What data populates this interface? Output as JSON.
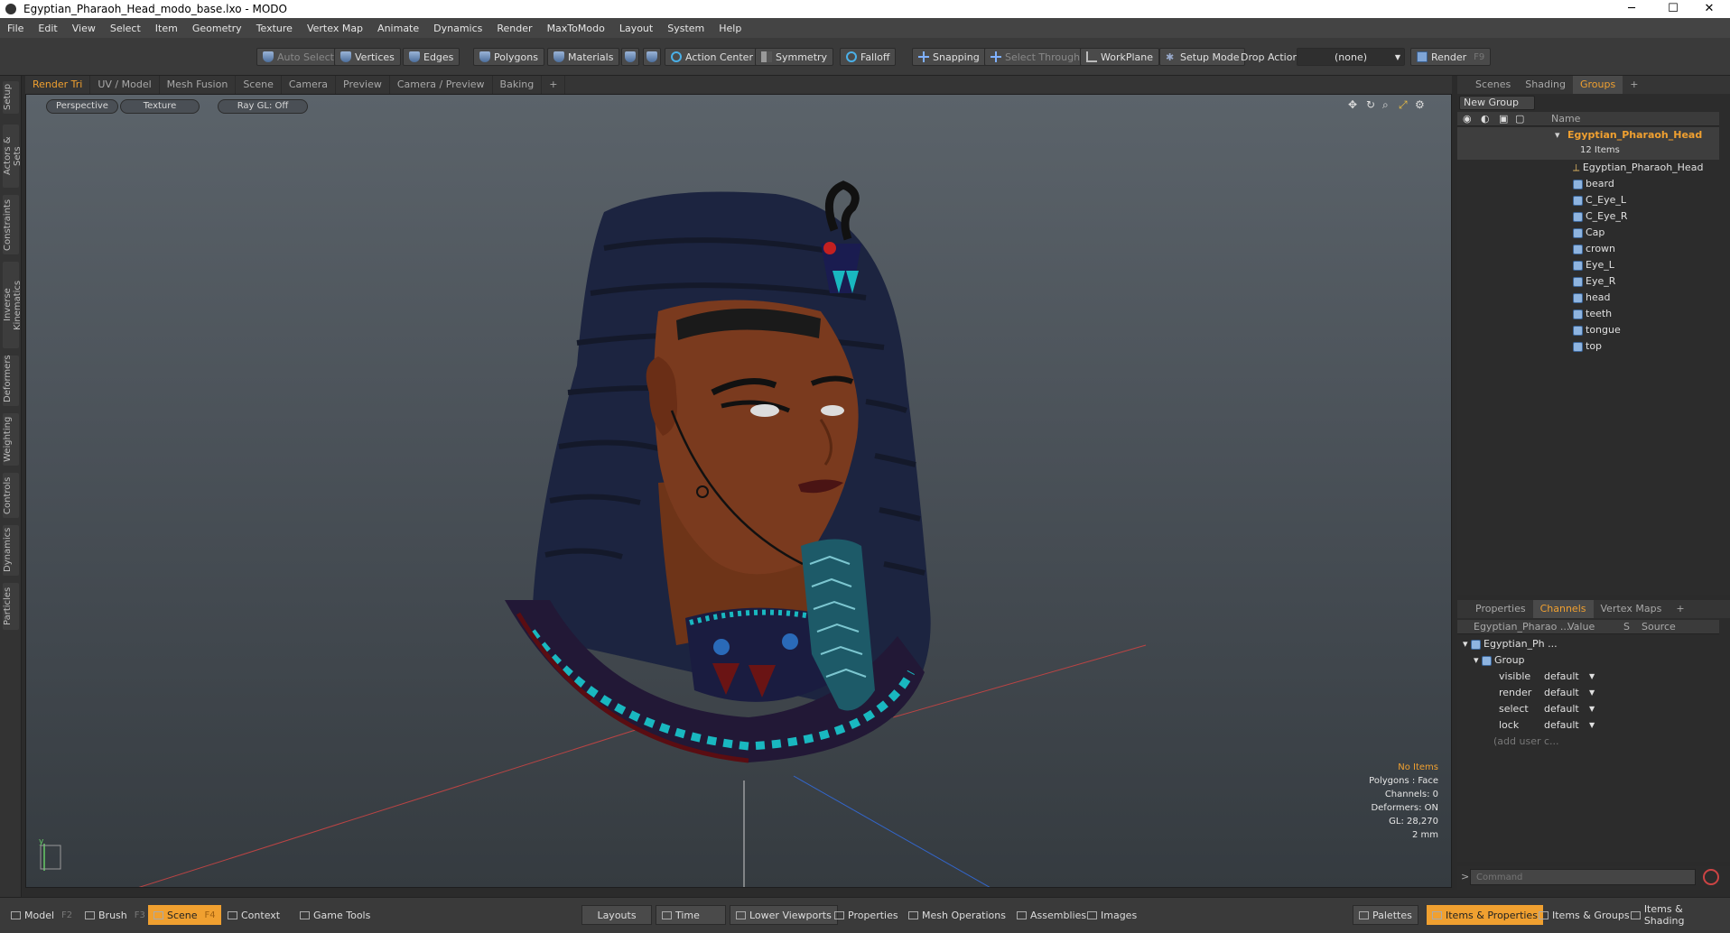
{
  "window": {
    "title": "Egyptian_Pharaoh_Head_modo_base.lxo - MODO",
    "minimize": "─",
    "maximize": "☐",
    "close": "✕"
  },
  "menu": [
    "File",
    "Edit",
    "View",
    "Select",
    "Item",
    "Geometry",
    "Texture",
    "Vertex Map",
    "Animate",
    "Dynamics",
    "Render",
    "MaxToModo",
    "Layout",
    "System",
    "Help"
  ],
  "toolbar": {
    "auto_select": "Auto Select",
    "vertices": "Vertices",
    "edges": "Edges",
    "polygons": "Polygons",
    "materials": "Materials",
    "action_center": "Action Center",
    "symmetry": "Symmetry",
    "falloff": "Falloff",
    "snapping": "Snapping",
    "select_through": "Select Through",
    "workplane": "WorkPlane",
    "setup_mode": "Setup Mode",
    "drop_action": "Drop Action",
    "drop_value": "(none)",
    "render": "Render",
    "render_key": "F9"
  },
  "left_tabs": [
    "Setup",
    "Actors & Sets",
    "Constraints",
    "Inverse Kinematics",
    "Deformers",
    "Weighting",
    "Controls",
    "Dynamics",
    "Particles"
  ],
  "viewport_tabs": [
    "Render Tri",
    "UV / Model",
    "Mesh Fusion",
    "Scene",
    "Camera",
    "Preview",
    "Camera / Preview",
    "Baking",
    "+"
  ],
  "viewport": {
    "view_mode": "Perspective",
    "shading": "Texture",
    "raygl": "Ray GL: Off",
    "status": {
      "items": "No Items",
      "polygons": "Polygons : Face",
      "channels": "Channels: 0",
      "deformers": "Deformers: ON",
      "gl": "GL: 28,270",
      "scale": "2 mm"
    }
  },
  "scene_panel": {
    "tabs": [
      "Scenes",
      "Shading",
      "Groups",
      "+"
    ],
    "new_group": "New Group",
    "col_name": "Name",
    "group_name": "Egyptian_Pharaoh_Head",
    "group_count": "12 Items",
    "items": [
      "Egyptian_Pharaoh_Head",
      "beard",
      "C_Eye_L",
      "C_Eye_R",
      "Cap",
      "crown",
      "Eye_L",
      "Eye_R",
      "head",
      "teeth",
      "tongue",
      "top"
    ]
  },
  "channels_panel": {
    "tabs": [
      "Properties",
      "Channels",
      "Vertex Maps",
      "+"
    ],
    "headers": {
      "name": "Egyptian_Pharao ...",
      "value": "Value",
      "s": "S",
      "source": "Source"
    },
    "root": "Egyptian_Ph ...",
    "group": "Group",
    "rows": [
      {
        "name": "visible",
        "value": "default"
      },
      {
        "name": "render",
        "value": "default"
      },
      {
        "name": "select",
        "value": "default"
      },
      {
        "name": "lock",
        "value": "default"
      }
    ],
    "add_user": "(add user c..."
  },
  "command": {
    "placeholder": "Command"
  },
  "bottom": {
    "model": "Model",
    "model_key": "F2",
    "brush": "Brush",
    "brush_key": "F3",
    "scene": "Scene",
    "scene_key": "F4",
    "context": "Context",
    "game_tools": "Game Tools",
    "layouts": "Layouts",
    "time": "Time",
    "lower_viewports": "Lower Viewports",
    "properties": "Properties",
    "mesh_operations": "Mesh Operations",
    "assemblies": "Assemblies",
    "images": "Images",
    "palettes": "Palettes",
    "items_properties": "Items & Properties",
    "items_groups": "Items & Groups",
    "items_shading": "Items & Shading"
  },
  "colors": {
    "accent": "#f0a030",
    "skin": "#7a3a1e",
    "headdress": "#1c2440",
    "turquoise": "#19b8c0"
  }
}
